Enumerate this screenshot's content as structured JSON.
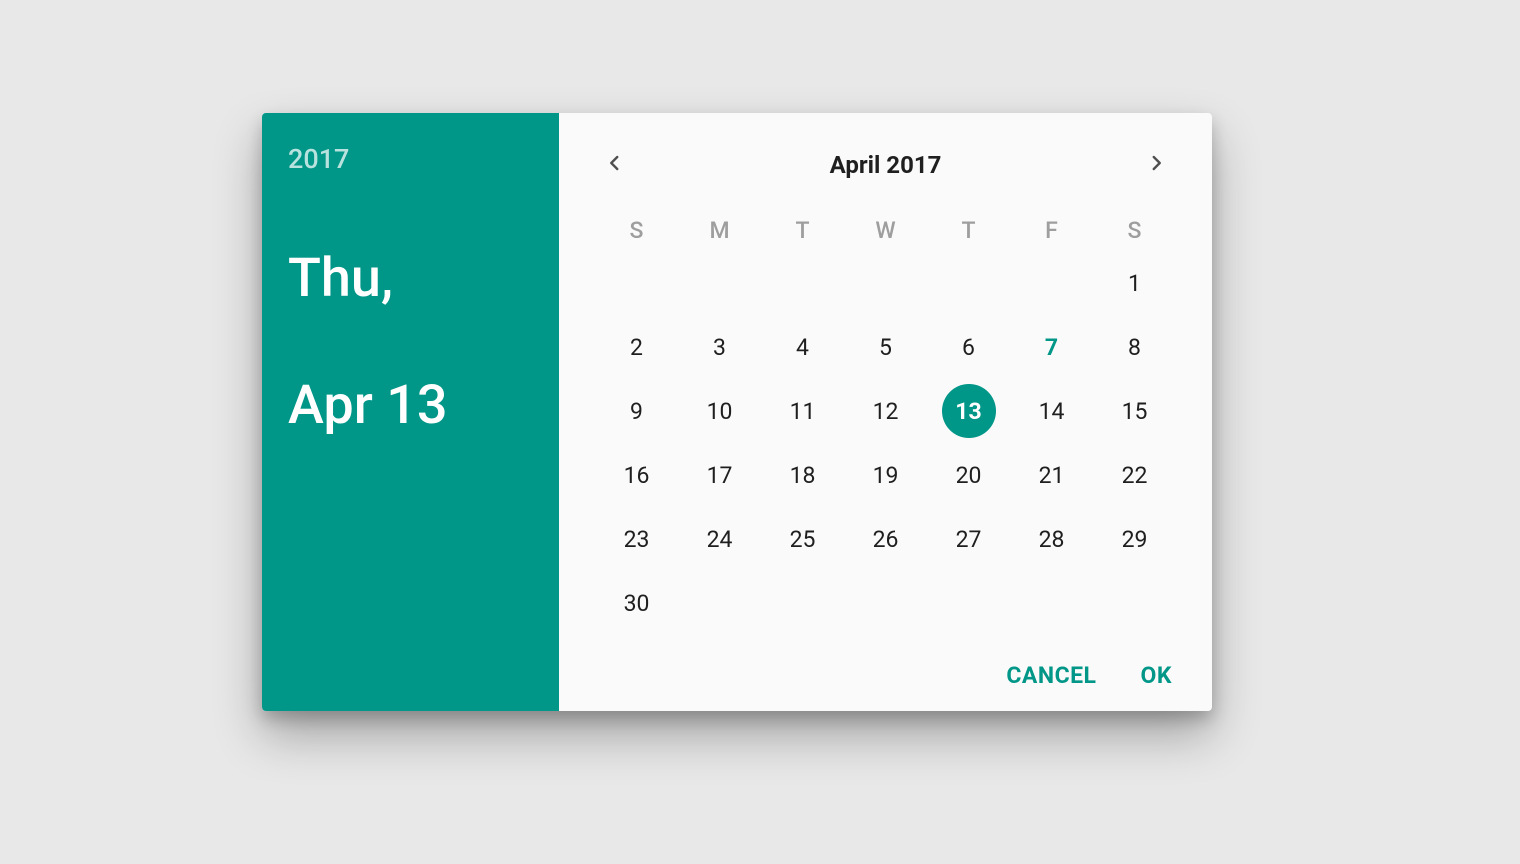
{
  "colors": {
    "accent": "#009688",
    "background": "#e8e8e8",
    "panel": "#fafafa"
  },
  "side": {
    "year": "2017",
    "date_line1": "Thu,",
    "date_line2": "Apr 13"
  },
  "calendar": {
    "month_label": "April 2017",
    "weekdays": [
      "S",
      "M",
      "T",
      "W",
      "T",
      "F",
      "S"
    ],
    "leading_blanks": 6,
    "days_in_month": 30,
    "selected_day": 13,
    "today": 7
  },
  "actions": {
    "cancel": "CANCEL",
    "ok": "OK"
  }
}
